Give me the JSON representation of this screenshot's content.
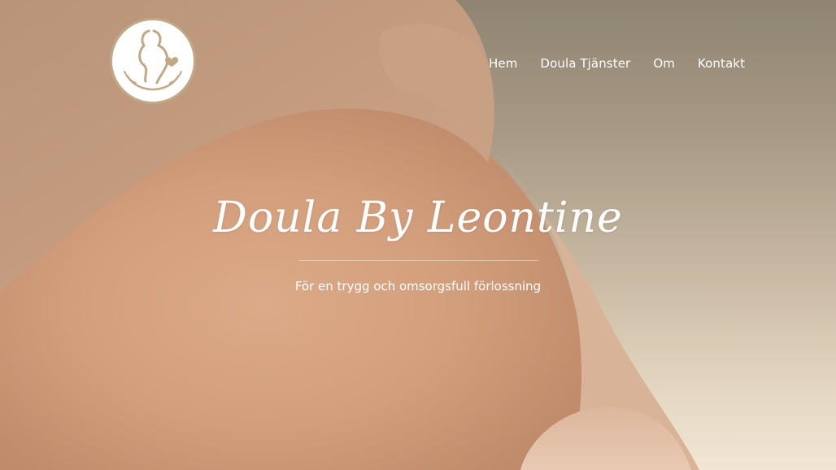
{
  "brand": {
    "logo_icon": "pregnant-silhouette-heart-hands-icon",
    "accent_color": "#c2a986"
  },
  "nav": {
    "items": [
      {
        "label": "Hem"
      },
      {
        "label": "Doula Tjänster"
      },
      {
        "label": "Om"
      },
      {
        "label": "Kontakt"
      }
    ]
  },
  "hero": {
    "title": "Doula By Leontine",
    "subtitle": "För en trygg och omsorgsfull förlossning",
    "background_image": "pregnant-belly-photo"
  }
}
